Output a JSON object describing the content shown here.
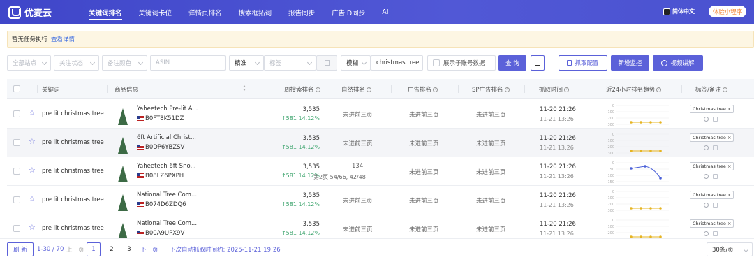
{
  "header": {
    "brand": "优麦云",
    "nav": [
      "关键词排名",
      "关键词卡位",
      "详情页排名",
      "搜索框拓词",
      "报告同步",
      "广告ID同步",
      "AI"
    ],
    "active_index": 0,
    "language": "简体中文",
    "mini_program": "体验小程序"
  },
  "notice": {
    "text": "暂无任务执行",
    "link": "查看详情"
  },
  "filters": {
    "site": "全部站点",
    "follow_status": "关注状态",
    "note_color": "备注颜色",
    "asin_placeholder": "ASIN",
    "match_mode": "精准",
    "tag_placeholder": "标签",
    "fuzzy_mode": "模糊",
    "keyword_value": "christmas tree",
    "show_sub_label": "展示子账号数据",
    "query_button": "查 询",
    "crawl_config": "抓取配置",
    "add_monitor": "新增监控",
    "video_guide": "视频讲解"
  },
  "table": {
    "headers": {
      "keyword": "关键词",
      "product": "商品信息",
      "weekly_rank": "周搜索排名",
      "natural_rank": "自然排名",
      "ad_rank": "广告排名",
      "sp_ad_rank": "SP广告排名",
      "crawl_time": "抓取时间",
      "trend": "近24小时排名趋势",
      "tags": "标签/备注"
    },
    "chart_axis": [
      "0",
      "100",
      "200",
      "300"
    ],
    "chart_axis_alt": [
      "0",
      "50",
      "100",
      "150"
    ],
    "rows": [
      {
        "keyword": "pre lit christmas tree",
        "product": "Yaheetech Pre-lit A...",
        "asin": "B0FT8K51DZ",
        "weekly": "3,535",
        "growth": "↑581  14.12%",
        "natural": "未进前三页",
        "natural_sub": "",
        "ad": "未进前三页",
        "sp": "未进前三页",
        "time1": "11-20 21:26",
        "time2": "11-21 13:26",
        "tag": "Christmas tree ×"
      },
      {
        "keyword": "pre lit christmas tree",
        "product": "6ft Artificial Christ...",
        "asin": "B0DP6YBZSV",
        "weekly": "3,535",
        "growth": "↑581  14.12%",
        "natural": "未进前三页",
        "natural_sub": "",
        "ad": "未进前三页",
        "sp": "未进前三页",
        "time1": "11-20 21:26",
        "time2": "11-21 13:26",
        "tag": "Christmas tree ×"
      },
      {
        "keyword": "pre lit christmas tree",
        "product": "Yaheetech 6ft Sno...",
        "asin": "B08LZ6PXPH",
        "weekly": "3,535",
        "growth": "↑581  14.12%",
        "natural": "134",
        "natural_sub": "第2页 54/66, 42/48",
        "ad": "未进前三页",
        "sp": "未进前三页",
        "time1": "11-20 21:26",
        "time2": "11-21 13:26",
        "tag": "Christmas tree ×"
      },
      {
        "keyword": "pre lit christmas tree",
        "product": "National Tree Com...",
        "asin": "B074D6ZDQ6",
        "weekly": "3,535",
        "growth": "↑581  14.12%",
        "natural": "未进前三页",
        "natural_sub": "",
        "ad": "未进前三页",
        "sp": "未进前三页",
        "time1": "11-20 21:26",
        "time2": "11-21 13:26",
        "tag": "Christmas tree ×"
      },
      {
        "keyword": "pre lit christmas tree",
        "product": "National Tree Com...",
        "asin": "B00A9UPX9V",
        "weekly": "3,535",
        "growth": "↑581  14.12%",
        "natural": "未进前三页",
        "natural_sub": "",
        "ad": "未进前三页",
        "sp": "未进前三页",
        "time1": "11-20 21:26",
        "time2": "11-21 13:26",
        "tag": "Christmas tree ×"
      }
    ]
  },
  "footer": {
    "refresh": "刷 新",
    "range": "1-30 / 70",
    "prev": "上一页",
    "pages": [
      "1",
      "2",
      "3"
    ],
    "next": "下一页",
    "next_crawl": "下次自动抓取时间约: 2025-11-21 19:26",
    "page_size": "30条/页"
  },
  "colors": {
    "brand": "#4a52d0",
    "accent": "#5b61d9",
    "growth": "#3aa36b",
    "trend_flat": "#e6b422",
    "trend_line": "#4a60d8"
  }
}
